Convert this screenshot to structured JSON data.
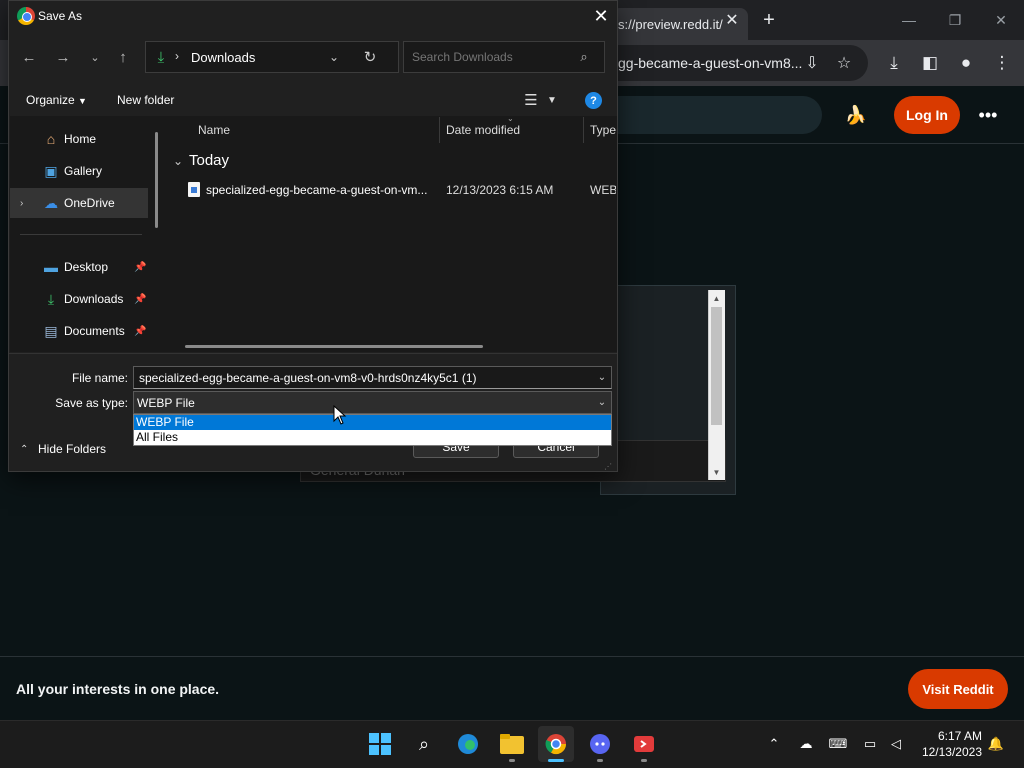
{
  "browser": {
    "tab_url": "s://preview.redd.it/",
    "omnibox_text": "gg-became-a-guest-on-vm8...",
    "icons": [
      "close-icon",
      "plus-icon",
      "minimize-icon",
      "restore-icon",
      "install-icon",
      "star-icon",
      "download-icon",
      "side-panel-icon",
      "profile-icon",
      "menu-icon"
    ]
  },
  "reddit": {
    "login_label": "Log In",
    "bg_panel_text": "General Dunan",
    "banner_text": "All your interests in one place.",
    "visit_label": "Visit Reddit",
    "accent": "#d93a00"
  },
  "dialog": {
    "title": "Save As",
    "address": "Downloads",
    "search_placeholder": "Search Downloads",
    "organize_label": "Organize",
    "new_folder_label": "New folder",
    "nav_items": [
      {
        "label": "Home",
        "icon": "home-icon"
      },
      {
        "label": "Gallery",
        "icon": "gallery-icon"
      },
      {
        "label": "OneDrive",
        "icon": "cloud-icon"
      },
      {
        "label": "Desktop",
        "icon": "desktop-icon"
      },
      {
        "label": "Downloads",
        "icon": "download-icon"
      },
      {
        "label": "Documents",
        "icon": "document-icon"
      }
    ],
    "columns": {
      "name": "Name",
      "date": "Date modified",
      "type": "Type"
    },
    "group": "Today",
    "files": [
      {
        "name": "specialized-egg-became-a-guest-on-vm...",
        "date": "12/13/2023 6:15 AM",
        "type": "WEBP"
      }
    ],
    "file_name_label": "File name:",
    "file_name_value": "specialized-egg-became-a-guest-on-vm8-v0-hrds0nz4ky5c1 (1)",
    "save_type_label": "Save as type:",
    "save_type_value": "WEBP File",
    "type_options": [
      "WEBP File",
      "All Files"
    ],
    "save_label": "Save",
    "cancel_label": "Cancel",
    "hide_folders_label": "Hide Folders",
    "selection_color": "#0078d7"
  },
  "taskbar": {
    "time": "6:17 AM",
    "date": "12/13/2023",
    "apps": [
      "windows-start-icon",
      "search-icon",
      "edge-icon",
      "file-explorer-icon",
      "chrome-icon",
      "discord-icon",
      "app-icon"
    ],
    "tray": [
      "chevron-up-icon",
      "cloud-off-icon",
      "keyboard-icon",
      "display-icon",
      "volume-icon",
      "bell-icon"
    ]
  }
}
